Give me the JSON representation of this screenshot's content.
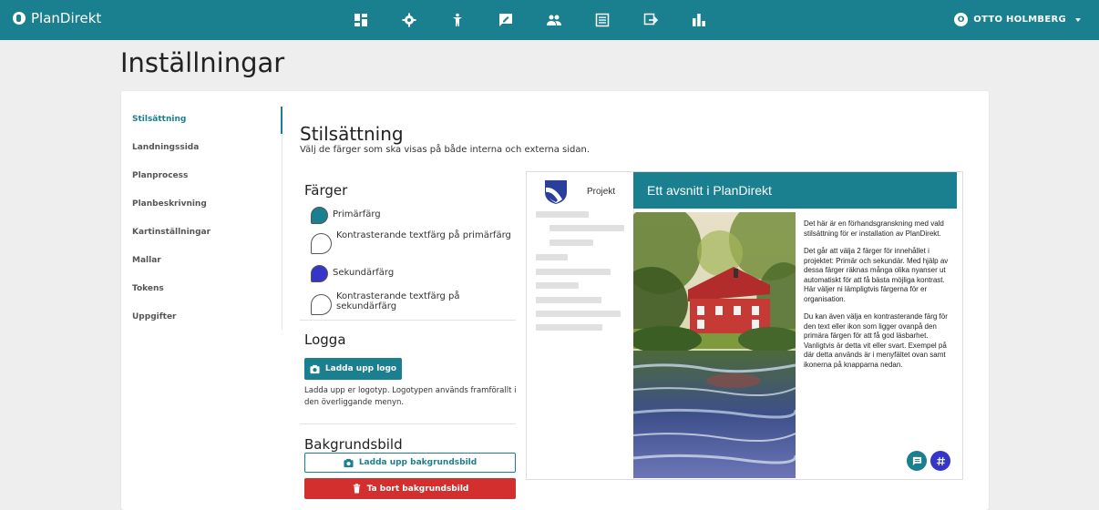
{
  "app": {
    "name": "PlanDirekt"
  },
  "nav": {
    "icons": [
      "dashboard-icon",
      "gear-icon",
      "person-icon",
      "feedback-icon",
      "people-icon",
      "list-icon",
      "move-icon",
      "chart-icon"
    ]
  },
  "user": {
    "initial": "O",
    "name": "OTTO HOLMBERG"
  },
  "page": {
    "title": "Inställningar"
  },
  "sidebar": {
    "items": [
      {
        "label": "Stilsättning",
        "active": true
      },
      {
        "label": "Landningssida"
      },
      {
        "label": "Planprocess"
      },
      {
        "label": "Planbeskrivning"
      },
      {
        "label": "Kartinställningar"
      },
      {
        "label": "Mallar"
      },
      {
        "label": "Tokens"
      },
      {
        "label": "Uppgifter"
      }
    ]
  },
  "section": {
    "title": "Stilsättning",
    "subtitle": "Välj de färger som ska visas på både interna och externa sidan."
  },
  "colors": {
    "heading": "Färger",
    "items": [
      {
        "label": "Primärfärg",
        "color": "#1a7f8e"
      },
      {
        "label": "Kontrasterande textfärg på primärfärg",
        "color": "#ffffff"
      },
      {
        "label": "Sekundärfärg",
        "color": "#3535c8"
      },
      {
        "label": "Kontrasterande textfärg på sekundärfärg",
        "color": "#ffffff"
      }
    ]
  },
  "logo": {
    "heading": "Logga",
    "upload_label": "Ladda upp logo",
    "help": "Ladda upp er logotyp. Logotypen används framförallt i den överliggande menyn."
  },
  "background": {
    "heading": "Bakgrundsbild",
    "upload_label": "Ladda upp bakgrundsbild",
    "remove_label": "Ta bort bakgrundsbild"
  },
  "preview": {
    "project_label": "Projekt",
    "header_title": "Ett avsnitt i PlanDirekt",
    "paragraphs": [
      "Det här är en förhandsgranskning med vald stilsättning för er installation av PlanDirekt.",
      "Det går att välja 2 färger för innehållet i projektet: Primär och sekundär. Med hjälp av dessa färger räknas många olika nyanser ut automatiskt för att få bästa möjliga kontrast. Här väljer ni lämpligtvis färgerna för er organisation.",
      "Du kan även välja en kontrasterande färg för den text eller ikon som ligger ovanpå den primära färgen för att få god läsbarhet. Vanligtvis är detta vit eller svart. Exempel på där detta används är i menyfältet ovan samt ikonerna på knapparna nedan."
    ]
  }
}
